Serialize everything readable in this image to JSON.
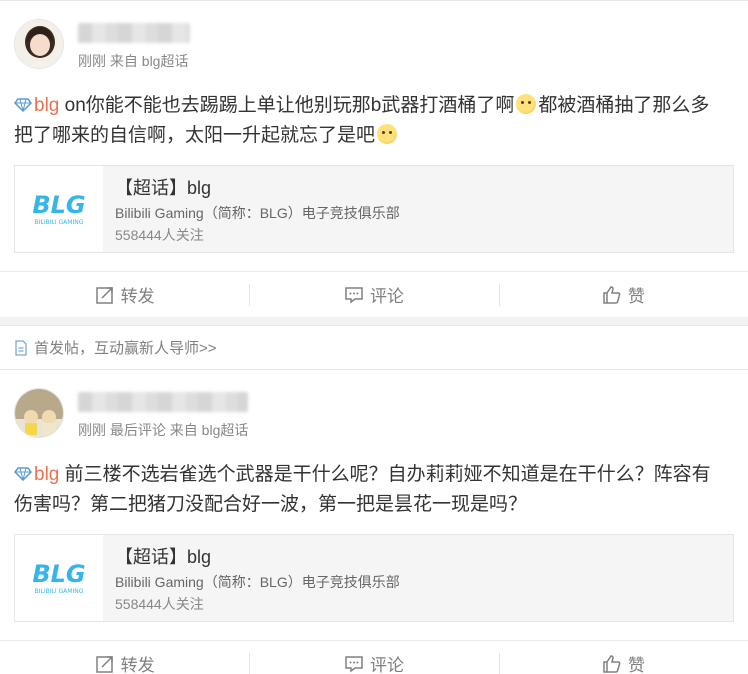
{
  "posts": [
    {
      "time": "刚刚",
      "source": "来自 blg超话",
      "tag": "blg",
      "text": " on你能不能也去踢踢上单让他别玩那b武器打酒桶了啊",
      "text2": "都被酒桶抽了那么多把了哪来的自信啊，太阳一升起就忘了是吧",
      "card": {
        "title": "【超话】blg",
        "desc": "Bilibili Gaming（简称：BLG）电子竞技俱乐部",
        "fans": "558444人关注"
      },
      "actions": {
        "repost": "转发",
        "comment": "评论",
        "like": "赞"
      }
    },
    {
      "time": "刚刚",
      "source": "最后评论 来自 blg超话",
      "tag": "blg",
      "text": " 前三楼不选岩雀选个武器是干什么呢？自办莉莉娅不知道是在干什么？阵容有伤害吗？第二把猪刀没配合好一波，第一把是昙花一现是吗？",
      "card": {
        "title": "【超话】blg",
        "desc": "Bilibili Gaming（简称：BLG）电子竞技俱乐部",
        "fans": "558444人关注"
      },
      "actions": {
        "repost": "转发",
        "comment": "评论",
        "like": "赞"
      }
    }
  ],
  "banner": {
    "text": "首发帖，互动赢新人导师>>"
  },
  "logo_text": {
    "main": "BLG",
    "sub": "BILIBILI GAMING"
  },
  "colors": {
    "accent": "#eb7350",
    "logo": "#35b5e8",
    "muted": "#808080"
  },
  "icons": [
    "diamond-icon",
    "emoji-icon",
    "repost-icon",
    "comment-icon",
    "like-icon",
    "document-icon"
  ]
}
